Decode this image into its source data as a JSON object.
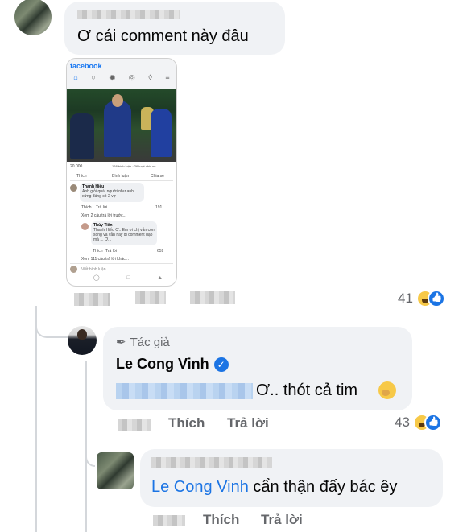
{
  "comment1": {
    "text": "Ơ cái comment này đâu",
    "reaction_count": "41"
  },
  "embedded_post": {
    "app_logo": "facebook",
    "nav_icons": [
      "home-icon",
      "friends-icon",
      "groups-icon",
      "profile-icon",
      "notifications-icon",
      "menu-icon"
    ],
    "reaction_count": "20.000",
    "stats": "168 bình luận · 26 lượt chia sẻ",
    "actions": {
      "like": "Thích",
      "comment": "Bình luận",
      "share": "Chia sẻ"
    },
    "comment1": {
      "author": "Thanh Hiếu",
      "text": "Anh giỏi quá, người như anh xứng đáng có 2 vợ",
      "like": "Thích",
      "reply": "Trả lời",
      "count": "191"
    },
    "see_more_1": "Xem 2 câu trả lời trước...",
    "comment2": {
      "author": "Thủy Tiên",
      "text": "Thanh Hiếu Ơ.. Em ơi chị vẫn còn sống và vẫn hay đi comment dạo mà ... Ơ...",
      "like": "Thích",
      "reply": "Trả lời",
      "count": "659"
    },
    "see_more_2": "Xem 111 câu trả lời khác...",
    "write_placeholder": "Viết bình luận"
  },
  "reply1": {
    "author_badge": "Tác giả",
    "author_name": "Le Cong Vinh",
    "text": "Ơ.. thót cả tim",
    "like_label": "Thích",
    "reply_label": "Trả lời",
    "reaction_count": "43"
  },
  "reply2": {
    "mention": "Le Cong Vinh",
    "text": "cẩn thận đấy bác êy",
    "like_label": "Thích",
    "reply_label": "Trả lời"
  },
  "colors": {
    "bubble": "#f0f2f5",
    "link_blue": "#1b74e4",
    "secondary_text": "#65676b"
  }
}
